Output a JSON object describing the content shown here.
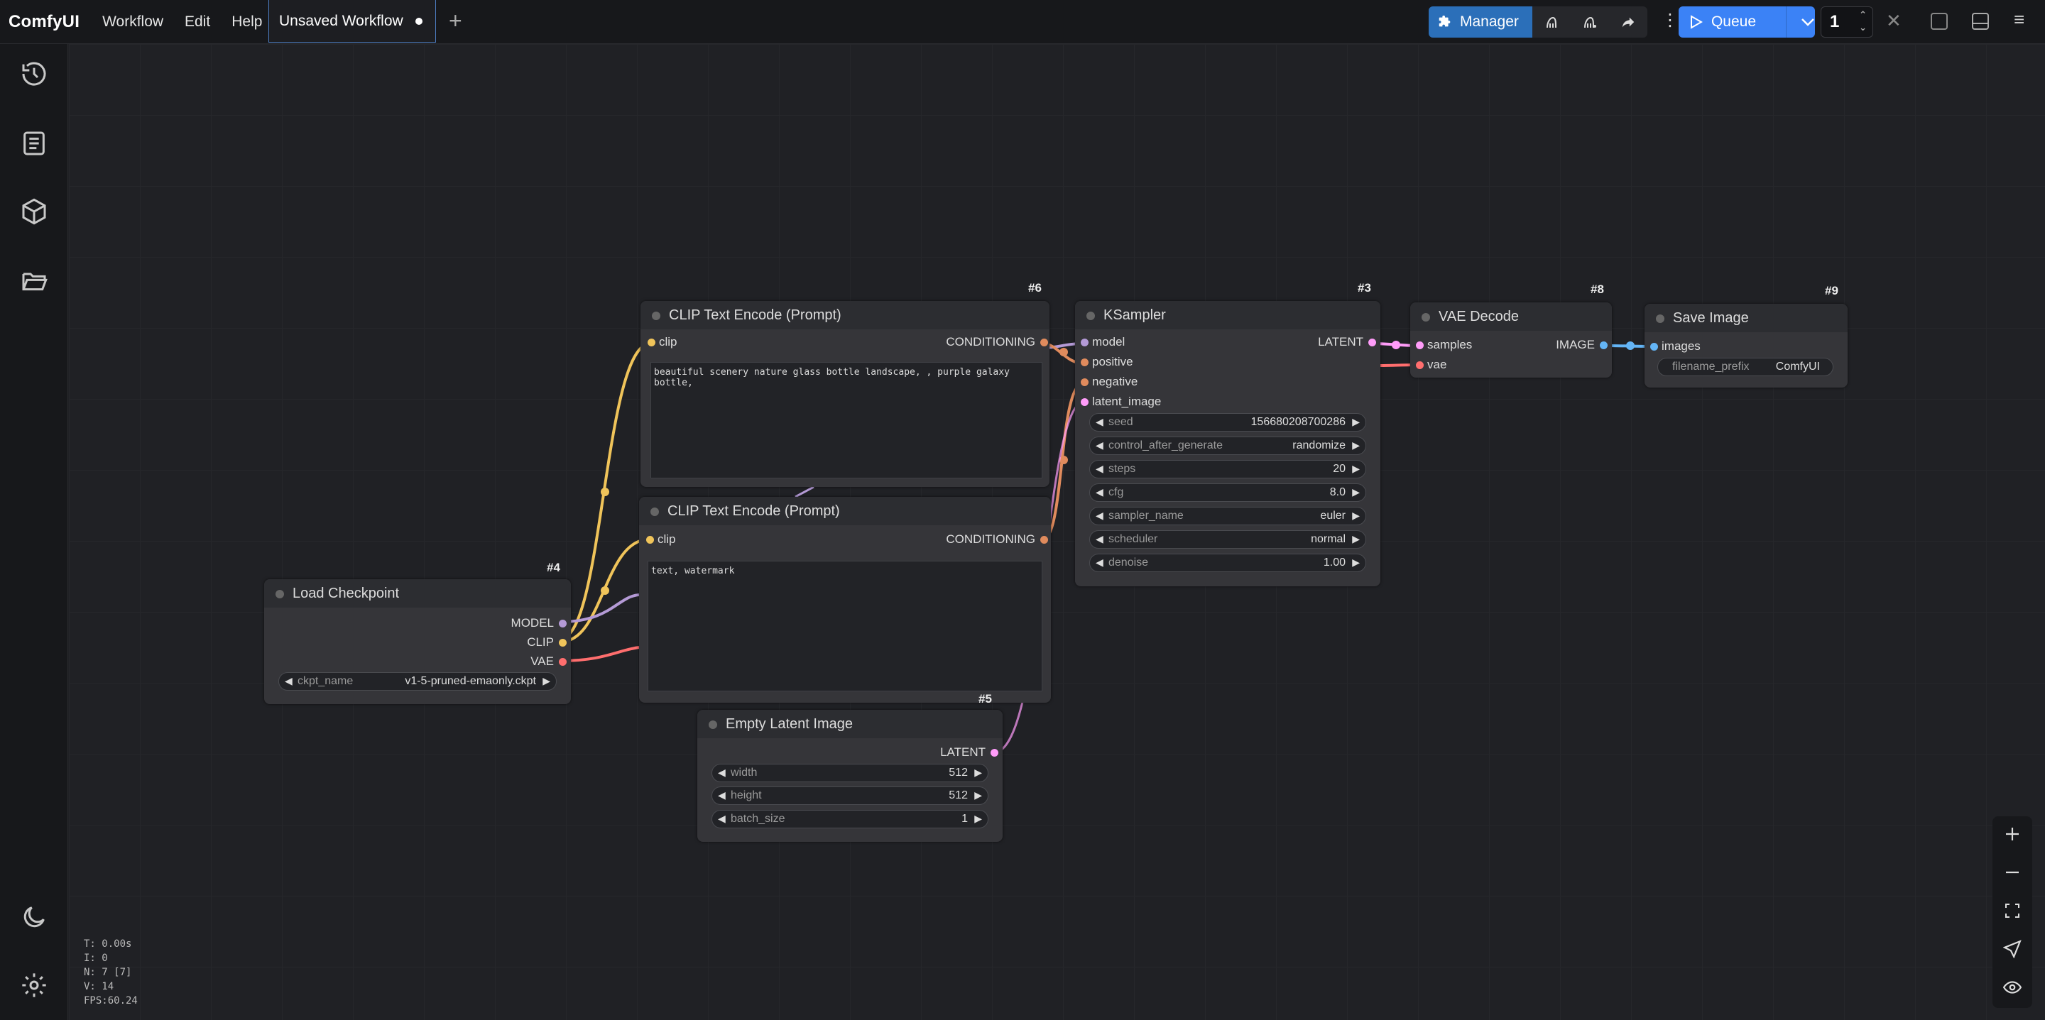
{
  "app": {
    "brand": "ComfyUI",
    "menu": [
      "Workflow",
      "Edit",
      "Help"
    ],
    "tab_title": "Unsaved Workflow"
  },
  "toolbar": {
    "manager_label": "Manager",
    "queue_label": "Queue",
    "queue_count": "1"
  },
  "nodes": {
    "clip_pos": {
      "id": "#6",
      "title": "CLIP Text Encode (Prompt)",
      "input": "clip",
      "output": "CONDITIONING",
      "text": "beautiful scenery nature glass bottle landscape, , purple galaxy bottle,"
    },
    "clip_neg": {
      "title": "CLIP Text Encode (Prompt)",
      "input": "clip",
      "output": "CONDITIONING",
      "text": "text, watermark"
    },
    "ksampler": {
      "id": "#3",
      "title": "KSampler",
      "inputs": [
        "model",
        "positive",
        "negative",
        "latent_image"
      ],
      "output": "LATENT",
      "widgets": [
        {
          "label": "seed",
          "value": "156680208700286"
        },
        {
          "label": "control_after_generate",
          "value": "randomize"
        },
        {
          "label": "steps",
          "value": "20"
        },
        {
          "label": "cfg",
          "value": "8.0"
        },
        {
          "label": "sampler_name",
          "value": "euler"
        },
        {
          "label": "scheduler",
          "value": "normal"
        },
        {
          "label": "denoise",
          "value": "1.00"
        }
      ]
    },
    "vae_decode": {
      "id": "#8",
      "title": "VAE Decode",
      "inputs": [
        "samples",
        "vae"
      ],
      "output": "IMAGE"
    },
    "save_image": {
      "id": "#9",
      "title": "Save Image",
      "input": "images",
      "widget": {
        "label": "filename_prefix",
        "value": "ComfyUI"
      }
    },
    "load_checkpoint": {
      "id": "#4",
      "title": "Load Checkpoint",
      "outputs": [
        "MODEL",
        "CLIP",
        "VAE"
      ],
      "widget": {
        "label": "ckpt_name",
        "value": "v1-5-pruned-emaonly.ckpt"
      }
    },
    "empty_latent": {
      "id": "#5",
      "title": "Empty Latent Image",
      "output": "LATENT",
      "widgets": [
        {
          "label": "width",
          "value": "512"
        },
        {
          "label": "height",
          "value": "512"
        },
        {
          "label": "batch_size",
          "value": "1"
        }
      ]
    }
  },
  "stats": [
    "T: 0.00s",
    "I: 0",
    "N: 7 [7]",
    "V: 14",
    "FPS:60.24"
  ],
  "colors": {
    "clip": "#f0c45a",
    "conditioning": "#e08b5d",
    "model": "#b49ad6",
    "latent": "#ff9cf9",
    "vae": "#ff6e6e",
    "image": "#64b5f6",
    "accent": "#3b82f6"
  }
}
